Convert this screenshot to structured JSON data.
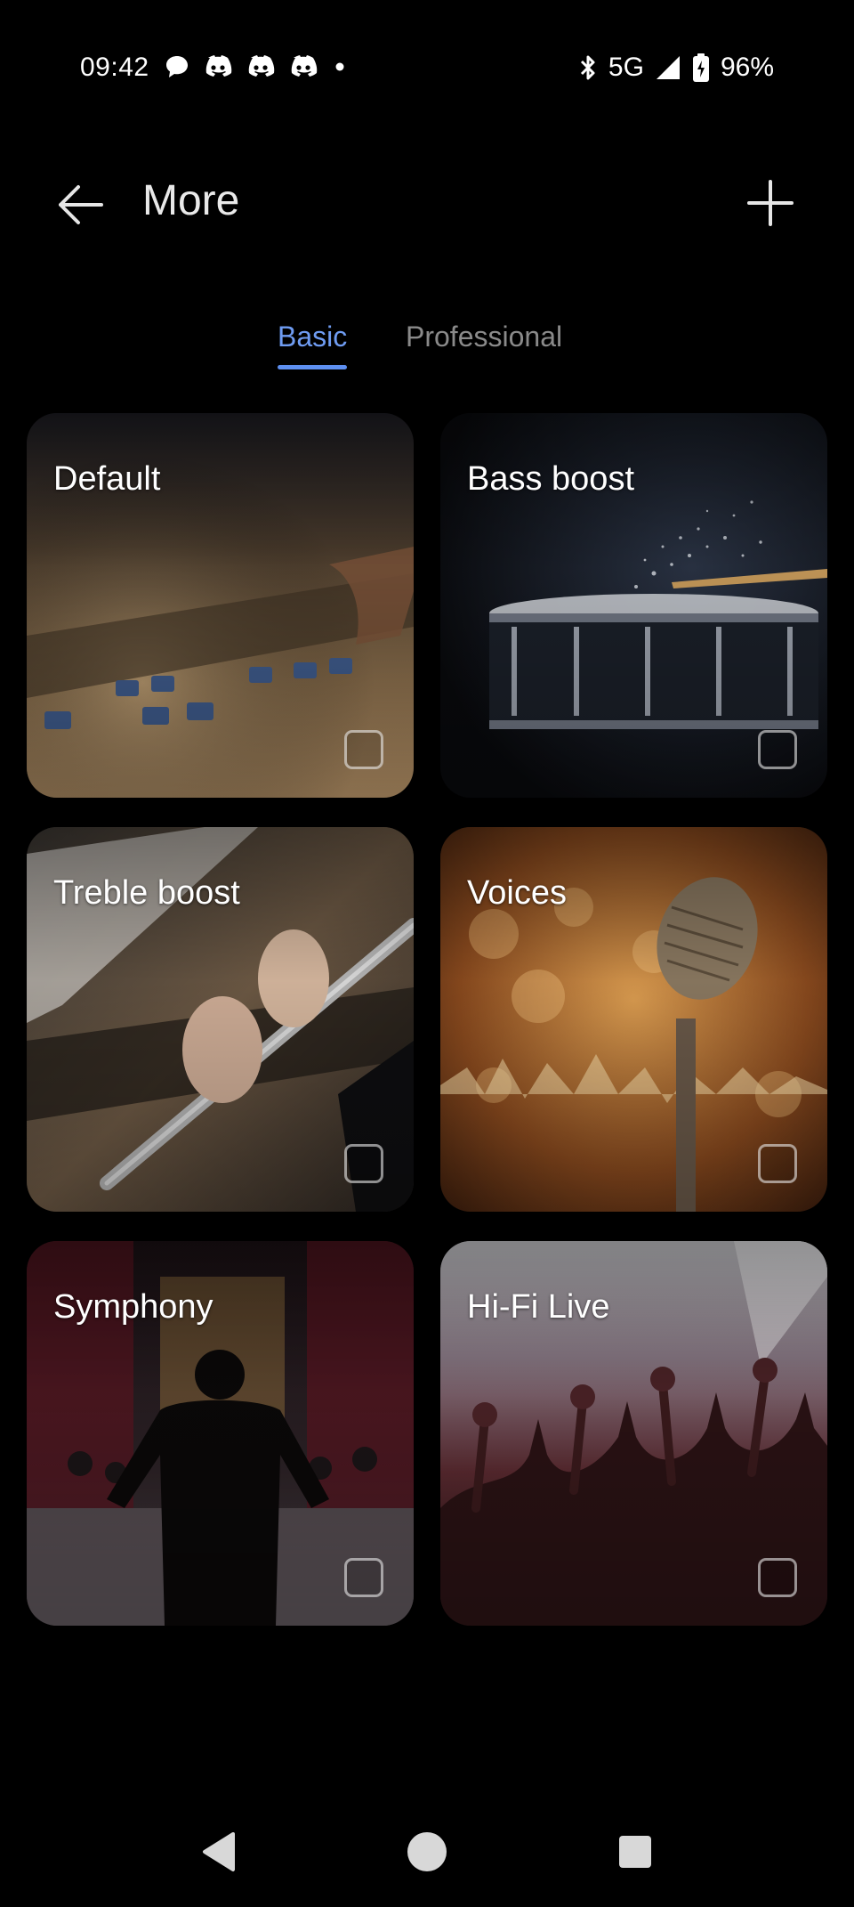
{
  "status_bar": {
    "time": "09:42",
    "network": "5G",
    "battery": "96%",
    "left_icons": [
      "chat-bubble-icon",
      "discord-icon",
      "discord-icon",
      "discord-icon",
      "dot-icon"
    ],
    "right_icons": [
      "bluetooth-icon",
      "signal-icon",
      "battery-icon"
    ]
  },
  "app_bar": {
    "title": "More",
    "back_icon": "arrow-left-icon",
    "add_icon": "plus-icon"
  },
  "tabs": [
    {
      "label": "Basic",
      "selected": true
    },
    {
      "label": "Professional",
      "selected": false
    }
  ],
  "colors": {
    "background": "#000000",
    "tab_active": "#6f9cf2",
    "tab_inactive": "#8a8a8a"
  },
  "presets": [
    {
      "label": "Default",
      "checked": false
    },
    {
      "label": "Bass boost",
      "checked": false
    },
    {
      "label": "Treble boost",
      "checked": false
    },
    {
      "label": "Voices",
      "checked": false
    },
    {
      "label": "Symphony",
      "checked": false
    },
    {
      "label": "Hi-Fi Live",
      "checked": false
    }
  ],
  "nav_bar": {
    "icons": [
      "nav-back-icon",
      "nav-home-icon",
      "nav-recents-icon"
    ]
  }
}
